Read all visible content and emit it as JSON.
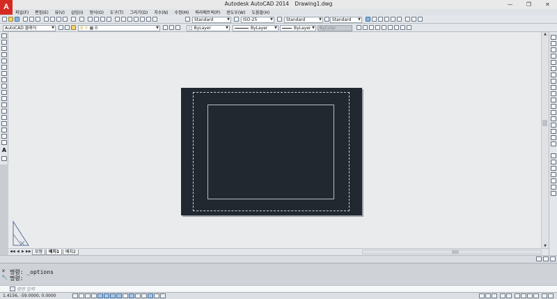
{
  "window": {
    "app_title": "Autodesk AutoCAD 2014",
    "document": "Drawing1.dwg",
    "logo_letter": "A",
    "minimize": "—",
    "restore": "❐",
    "close": "✕"
  },
  "menu": [
    "파일(F)",
    "편집(E)",
    "뷰(V)",
    "삽입(I)",
    "형식(O)",
    "도구(T)",
    "그리기(D)",
    "치수(N)",
    "수정(M)",
    "파라메트릭(P)",
    "윈도우(W)",
    "도움말(H)"
  ],
  "toolbar_top": {
    "text_style": "Standard",
    "dim_style": "ISO-25",
    "table_style": "Standard",
    "multileader_style": "Standard"
  },
  "toolbar_properties": {
    "workspace": "AutoCAD 클래식",
    "layer": "0",
    "color": "ByLayer",
    "linetype": "ByLayer",
    "lineweight": "ByLayer",
    "plotstyle": "ByColor"
  },
  "layout_tabs": [
    "모형",
    "배치1",
    "배치2"
  ],
  "active_tab_index": 1,
  "tab_nav": [
    "◀◀",
    "◀",
    "▶",
    "▶▶"
  ],
  "command": {
    "history": [
      "명령: _options",
      "명령:"
    ],
    "placeholder": "명령 입력"
  },
  "status": {
    "coordinates": "1.4156, -59.0000, 0.0000"
  },
  "colors": {
    "paper": "#212830",
    "canvas": "#eaebec",
    "accent": "#d52a22"
  },
  "icons": {
    "ucs": "ucs-triangle-icon",
    "close_cmd": "close-icon",
    "wrench": "wrench-icon"
  }
}
